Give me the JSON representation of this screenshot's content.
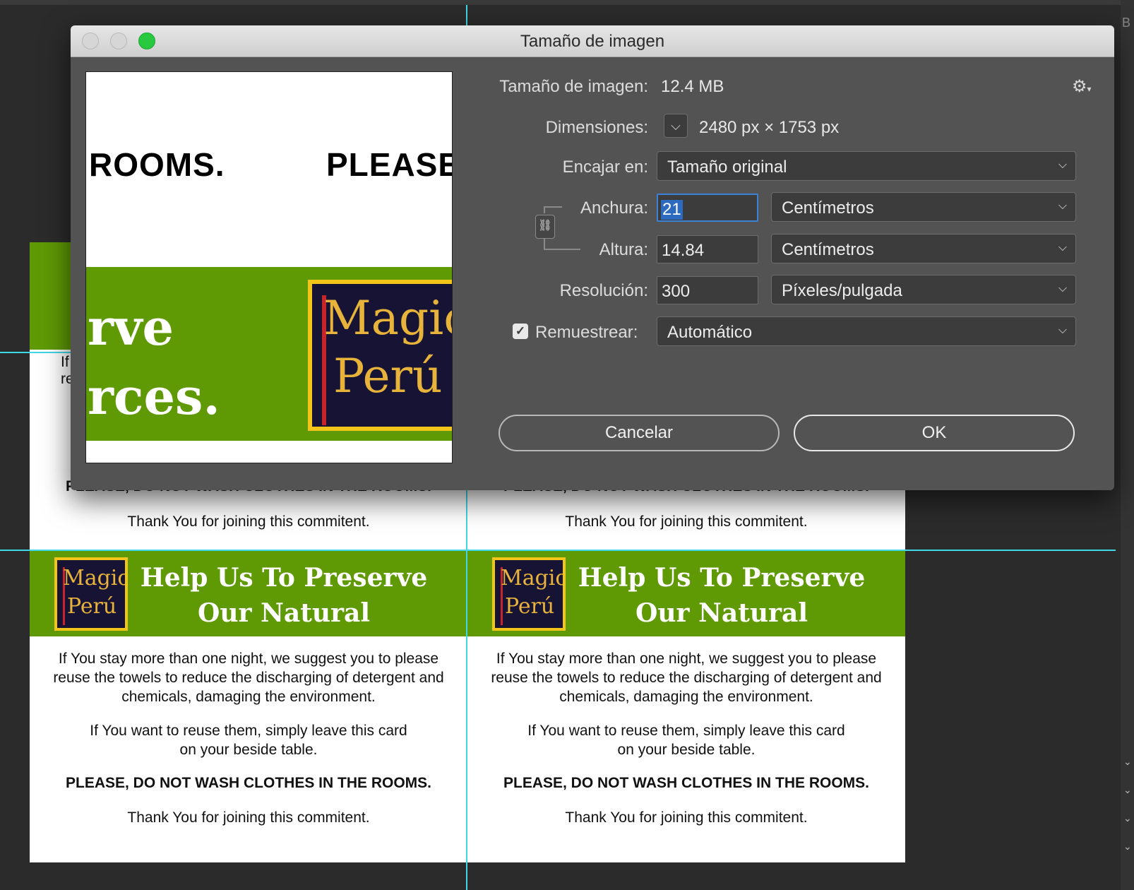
{
  "dialog": {
    "title": "Tamaño de imagen",
    "size_label": "Tamaño de imagen:",
    "size_value": "12.4 MB",
    "dimensions_label": "Dimensiones:",
    "dimensions_value": "2480 px × 1753 px",
    "fit_label": "Encajar en:",
    "fit_value": "Tamaño original",
    "width_label": "Anchura:",
    "width_value": "21",
    "width_unit": "Centímetros",
    "height_label": "Altura:",
    "height_value": "14.84",
    "height_unit": "Centímetros",
    "resolution_label": "Resolución:",
    "resolution_value": "300",
    "resolution_unit": "Píxeles/pulgada",
    "resample_label": "Remuestrear:",
    "resample_checked": true,
    "resample_value": "Automático",
    "cancel_label": "Cancelar",
    "ok_label": "OK"
  },
  "preview": {
    "line1_left": "ROOMS.",
    "line1_right": "PLEASE,",
    "green_word1": "rve",
    "green_word2": "rces.",
    "logo_line1": "Magic",
    "logo_line2": "Perú"
  },
  "card": {
    "title_line1": "Help Us To Preserve",
    "title_line2": "Our Natural Resources.",
    "para1_line1": "If You stay more than one night, we suggest you to please",
    "para1_line2": "reuse the towels to reduce the  discharging of detergent and",
    "para1_line3": "chemicals, damaging the environment.",
    "para2_line1": "If You want to reuse them, simply leave this card",
    "para2_line2": "on your beside table.",
    "warning": "PLEASE, DO NOT WASH CLOTHES IN THE ROOMS.",
    "thanks": "Thank You for joining this commitent.",
    "partial_left_line1": "If",
    "partial_left_line2": "re",
    "logo_line1": "Magic",
    "logo_line2": "Perú"
  },
  "icons": {
    "gear": "gear-icon",
    "link": "chain-link-icon",
    "chevron": "chevron-down-icon",
    "check": "checkmark-icon"
  },
  "colors": {
    "banner_green": "#5f9a05",
    "logo_navy": "#161335",
    "logo_border": "#f2c518",
    "guide_cyan": "#3fd6e6",
    "dialog_bg": "#535353",
    "selection_blue": "#2d6bc1",
    "traffic_green": "#28c840"
  },
  "right_panel": {
    "letter": "B"
  }
}
